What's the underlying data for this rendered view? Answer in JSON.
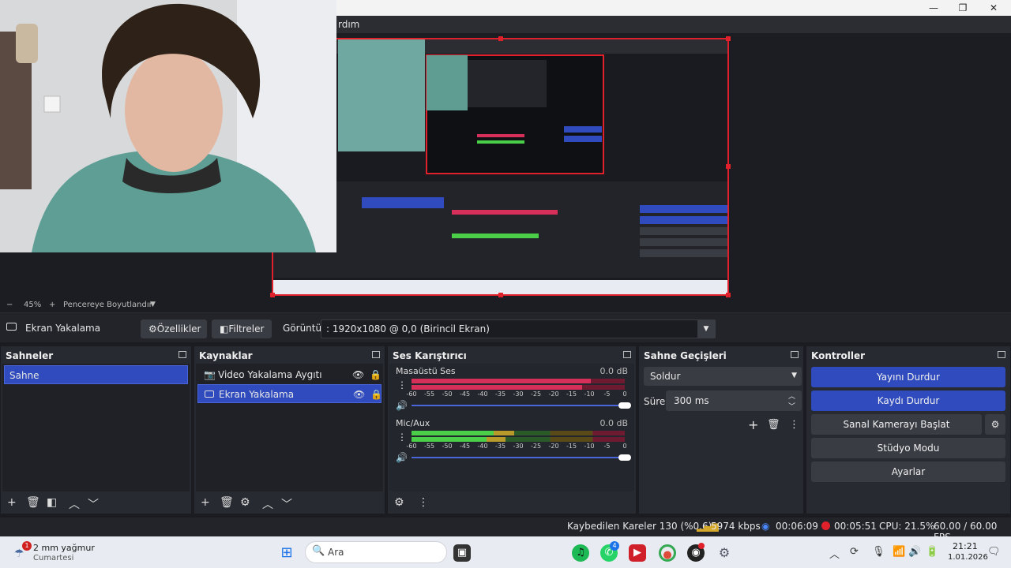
{
  "window": {
    "menu_fragment": "rdım",
    "minimize": "—",
    "maximize": "❐",
    "close": "✕"
  },
  "preview": {
    "zoom_minus": "−",
    "zoom_value": "45%",
    "zoom_plus": "+",
    "fit_label": "Pencereye Boyutlandır"
  },
  "source_toolbar": {
    "source_name": "Ekran Yakalama",
    "properties": "Özellikler",
    "filters": "Filtreler",
    "display_label": "Görüntü",
    "display_value": ": 1920x1080 @ 0,0 (Birincil Ekran)"
  },
  "scenes": {
    "title": "Sahneler",
    "items": [
      "Sahne"
    ]
  },
  "sources": {
    "title": "Kaynaklar",
    "items": [
      "Video Yakalama Aygıtı",
      "Ekran Yakalama"
    ]
  },
  "mixer": {
    "title": "Ses Karıştırıcı",
    "channels": [
      {
        "name": "Masaüstü Ses",
        "db": "0.0 dB",
        "level_left": 0.84,
        "level_right": 0.8
      },
      {
        "name": "Mic/Aux",
        "db": "0.0 dB",
        "level_left": 0.48,
        "level_right": 0.44
      }
    ],
    "ticks": [
      "-60",
      "-55",
      "-50",
      "-45",
      "-40",
      "-35",
      "-30",
      "-25",
      "-20",
      "-15",
      "-10",
      "-5",
      "0"
    ]
  },
  "transitions": {
    "title": "Sahne Geçişleri",
    "type": "Soldur",
    "duration_label": "Süre",
    "duration_value": "300 ms"
  },
  "controls": {
    "title": "Kontroller",
    "stop_stream": "Yayını Durdur",
    "stop_record": "Kaydı Durdur",
    "virtual_cam": "Sanal Kamerayı Başlat",
    "studio_mode": "Stüdyo Modu",
    "settings": "Ayarlar"
  },
  "statusbar": {
    "dropped": "Kaybedilen Kareler 130 (%0.6)",
    "bitrate": "5974 kbps",
    "stream_time": "00:06:09",
    "rec_time": "00:05:51",
    "cpu": "CPU: 21.5%",
    "fps": "60.00 / 60.00 FPS"
  },
  "taskbar": {
    "weather_title": "2 mm yağmur",
    "weather_sub": "Cumartesi",
    "weather_badge": "1",
    "search_placeholder": "Ara",
    "whatsapp_badge": "4",
    "time": "21:21",
    "date": "1.01.2026"
  },
  "colors": {
    "accent": "#2f4bbd",
    "record_red": "#e0202a",
    "meter_red": "#d6305a",
    "meter_green": "#4ccf48",
    "meter_yellow": "#b89a2a"
  }
}
